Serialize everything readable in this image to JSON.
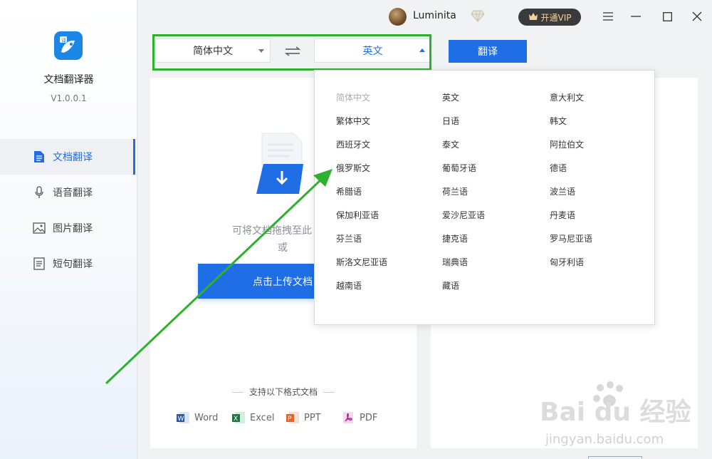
{
  "app": {
    "name": "文档翻译器",
    "version": "V1.0.0.1"
  },
  "nav": [
    {
      "label": "文档翻译",
      "icon": "document-icon",
      "active": true
    },
    {
      "label": "语音翻译",
      "icon": "microphone-icon",
      "active": false
    },
    {
      "label": "图片翻译",
      "icon": "image-icon",
      "active": false
    },
    {
      "label": "短句翻译",
      "icon": "text-lines-icon",
      "active": false
    }
  ],
  "titlebar": {
    "username": "Luminita",
    "vip_label": "开通VIP"
  },
  "toolbar": {
    "source_lang": "简体中文",
    "target_lang": "英文",
    "translate_label": "翻译"
  },
  "upload": {
    "drop_hint": "可将文档拖拽至此",
    "or": "或",
    "button_label": "点击上传文档"
  },
  "formats": {
    "title": "支持以下格式文档",
    "items": [
      {
        "label": "Word",
        "color": "#2b579a"
      },
      {
        "label": "Excel",
        "color": "#217346"
      },
      {
        "label": "PPT",
        "color": "#e0672b"
      },
      {
        "label": "PDF",
        "color": "#b0228c"
      }
    ]
  },
  "dropdown": {
    "selected": "简体中文",
    "languages": [
      "简体中文",
      "英文",
      "意大利文",
      "繁体中文",
      "日语",
      "韩文",
      "西班牙文",
      "泰文",
      "阿拉伯文",
      "俄罗斯文",
      "葡萄牙语",
      "德语",
      "希腊语",
      "荷兰语",
      "波兰语",
      "保加利亚语",
      "爱沙尼亚语",
      "丹麦语",
      "芬兰语",
      "捷克语",
      "罗马尼亚语",
      "斯洛文尼亚语",
      "瑞典语",
      "匈牙利语",
      "越南语",
      "藏语"
    ]
  },
  "watermark": {
    "brand": "Bai du 经验",
    "url": "jingyan.baidu.com"
  },
  "colors": {
    "accent": "#1f6ee5",
    "highlight": "#2fb12f",
    "vip_text": "#f3d29a"
  }
}
